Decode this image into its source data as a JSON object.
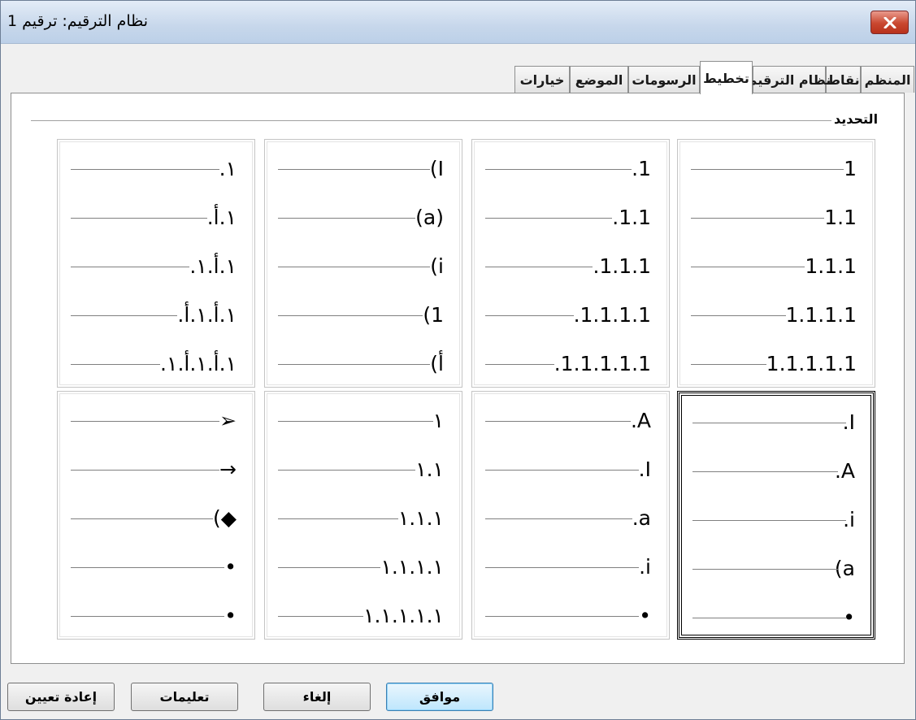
{
  "window": {
    "title": "نظام الترقيم: ترقيم 1",
    "close_icon": "close-icon"
  },
  "tabs": [
    {
      "label": "المنظم"
    },
    {
      "label": "نقاط"
    },
    {
      "label": "نظام الترقيم"
    },
    {
      "label": "تخطيط",
      "active": true
    },
    {
      "label": "الرسومات"
    },
    {
      "label": "الموضع"
    },
    {
      "label": "خيارات"
    }
  ],
  "group": {
    "label": "التحديد"
  },
  "presets": [
    [
      "1",
      "1.1",
      "1.1.1",
      "1.1.1.1",
      "1.1.1.1.1"
    ],
    [
      ".1",
      ".1.1",
      ".1.1.1",
      ".1.1.1.1",
      ".1.1.1.1.1"
    ],
    [
      "(I",
      "(a)",
      "(i",
      "(1",
      "(أ"
    ],
    [
      ".١",
      ".١.أ",
      ".١.أ.١",
      ".١.أ.١.أ",
      ".١.أ.١.أ.١"
    ],
    [
      ".I",
      ".A",
      ".i",
      "(a",
      "•"
    ],
    [
      ".A",
      ".I",
      ".a",
      ".i",
      "•"
    ],
    [
      "١",
      "١.١",
      "١.١.١",
      "١.١.١.١",
      "١.١.١.١.١"
    ],
    [
      "➢",
      "→",
      "(◆",
      "•",
      "•"
    ]
  ],
  "selected_preset": 4,
  "buttons": {
    "reset": "إعادة تعيين",
    "help": "تعليمات",
    "cancel": "إلغاء",
    "ok": "موافق"
  }
}
